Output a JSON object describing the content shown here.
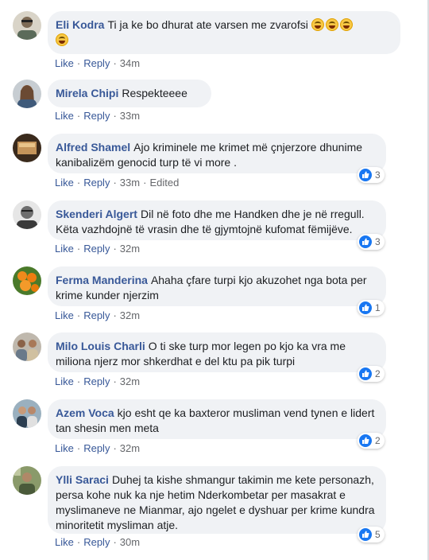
{
  "colors": {
    "author": "#385898",
    "bubble": "#f0f2f5",
    "meta": "#65676b",
    "like": "#1877f2"
  },
  "labels": {
    "like": "Like",
    "reply": "Reply",
    "separator": "·"
  },
  "comments": [
    {
      "author": "Eli Kodra",
      "text": "Ti ja ke bo dhurat ate varsen me zvarofsi",
      "emoji": "laughing-emoji",
      "time": "34m",
      "edited": "",
      "reactions": ""
    },
    {
      "author": "Mirela Chipi",
      "text": "Respekteeee",
      "time": "33m",
      "edited": "",
      "reactions": ""
    },
    {
      "author": "Alfred Shamel",
      "text": "Ajo kriminele me krimet më çnjerzore dhunime kanibalizëm genocid turp të vi more .",
      "time": "33m",
      "edited": "Edited",
      "reactions": "3"
    },
    {
      "author": "Skenderi Algert",
      "text": "Dil në foto dhe me Handken dhe je në rregull. Këta vazhdojnë të vrasin dhe të gjymtojnë kufomat fëmijëve.",
      "time": "32m",
      "edited": "",
      "reactions": "3"
    },
    {
      "author": "Ferma Manderina",
      "text": "Ahaha çfare turpi kjo akuzohet nga bota per krime kunder njerzim",
      "time": "32m",
      "edited": "",
      "reactions": "1"
    },
    {
      "author": "Milo Louis Charli",
      "text": "O ti ske turp mor legen po kjo ka vra me miliona njerz mor shkerdhat e del ktu pa pik turpi",
      "time": "32m",
      "edited": "",
      "reactions": "2"
    },
    {
      "author": "Azem Voca",
      "text": "kjo esht qe ka baxteror musliman vend tynen e lidert tan shesin men meta",
      "time": "32m",
      "edited": "",
      "reactions": "2"
    },
    {
      "author": "Ylli Saraci",
      "text": "Duhej ta kishe shmangur takimin me kete personazh, persa kohe nuk ka nje hetim Nderkombetar per masakrat e myslimaneve ne Mianmar, ajo ngelet e dyshuar per krime kundra minoritetit mysliman atje.",
      "time": "30m",
      "edited": "",
      "reactions": "5"
    }
  ]
}
